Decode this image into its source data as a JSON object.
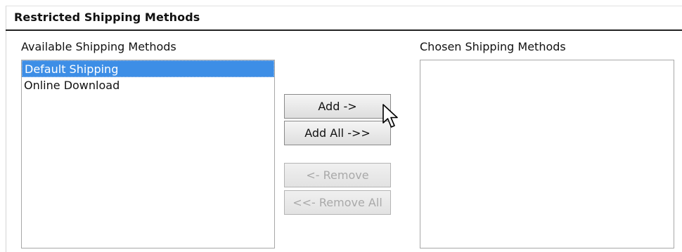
{
  "section": {
    "title": "Restricted Shipping Methods"
  },
  "available": {
    "label": "Available Shipping Methods",
    "items": [
      {
        "label": "Default Shipping",
        "selected": true
      },
      {
        "label": "Online Download",
        "selected": false
      }
    ]
  },
  "chosen": {
    "label": "Chosen Shipping Methods",
    "items": []
  },
  "buttons": {
    "add": {
      "label": "Add ->",
      "enabled": true
    },
    "add_all": {
      "label": "Add All ->>",
      "enabled": true
    },
    "remove": {
      "label": "<- Remove",
      "enabled": false
    },
    "remove_all": {
      "label": "<<- Remove All",
      "enabled": false
    }
  },
  "colors": {
    "selection": "#3d8ee6",
    "disabled_text": "#a9a9a9"
  },
  "cursor": {
    "icon": "arrow-pointer-icon"
  }
}
